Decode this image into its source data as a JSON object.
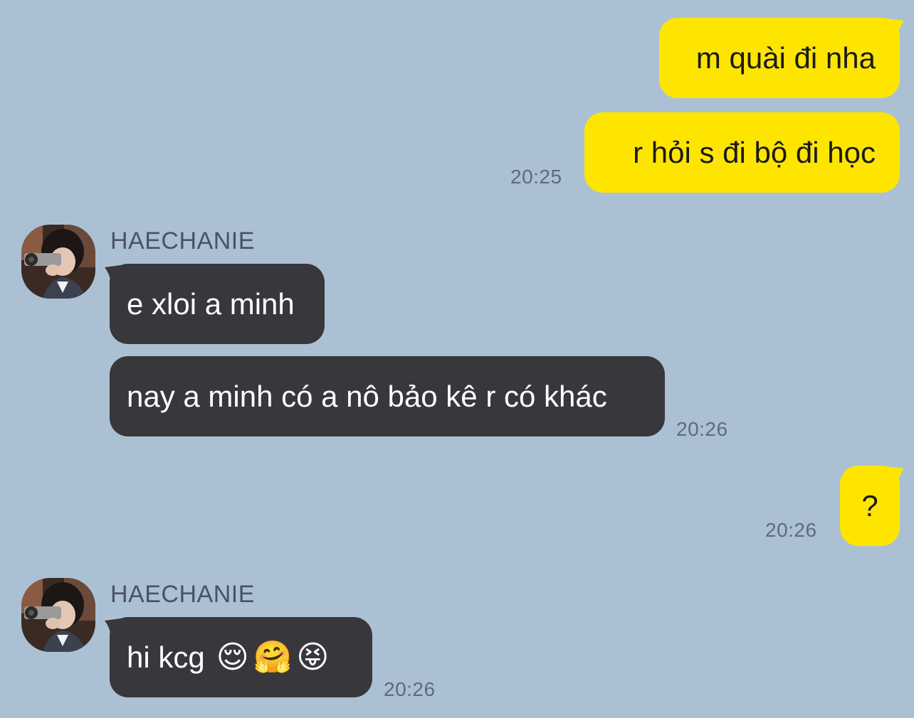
{
  "contact": {
    "name": "HAECHANIE"
  },
  "messages": [
    {
      "sender": "me",
      "text": "m quài đi nha"
    },
    {
      "sender": "me",
      "text": "r hỏi s đi bộ đi học",
      "time": "20:25"
    },
    {
      "sender": "HAECHANIE",
      "text": "e xloi a minh"
    },
    {
      "sender": "HAECHANIE",
      "text": "nay a minh có a nô bảo kê r có khác",
      "time": "20:26"
    },
    {
      "sender": "me",
      "text": "?",
      "time": "20:26"
    },
    {
      "sender": "HAECHANIE",
      "text": "hi kcg",
      "emojis": [
        "😌",
        "🤗",
        "😝"
      ],
      "time": "20:26"
    }
  ],
  "colors": {
    "background": "#abc1d3",
    "outgoing_bubble": "#fee500",
    "incoming_bubble": "#38373c"
  }
}
